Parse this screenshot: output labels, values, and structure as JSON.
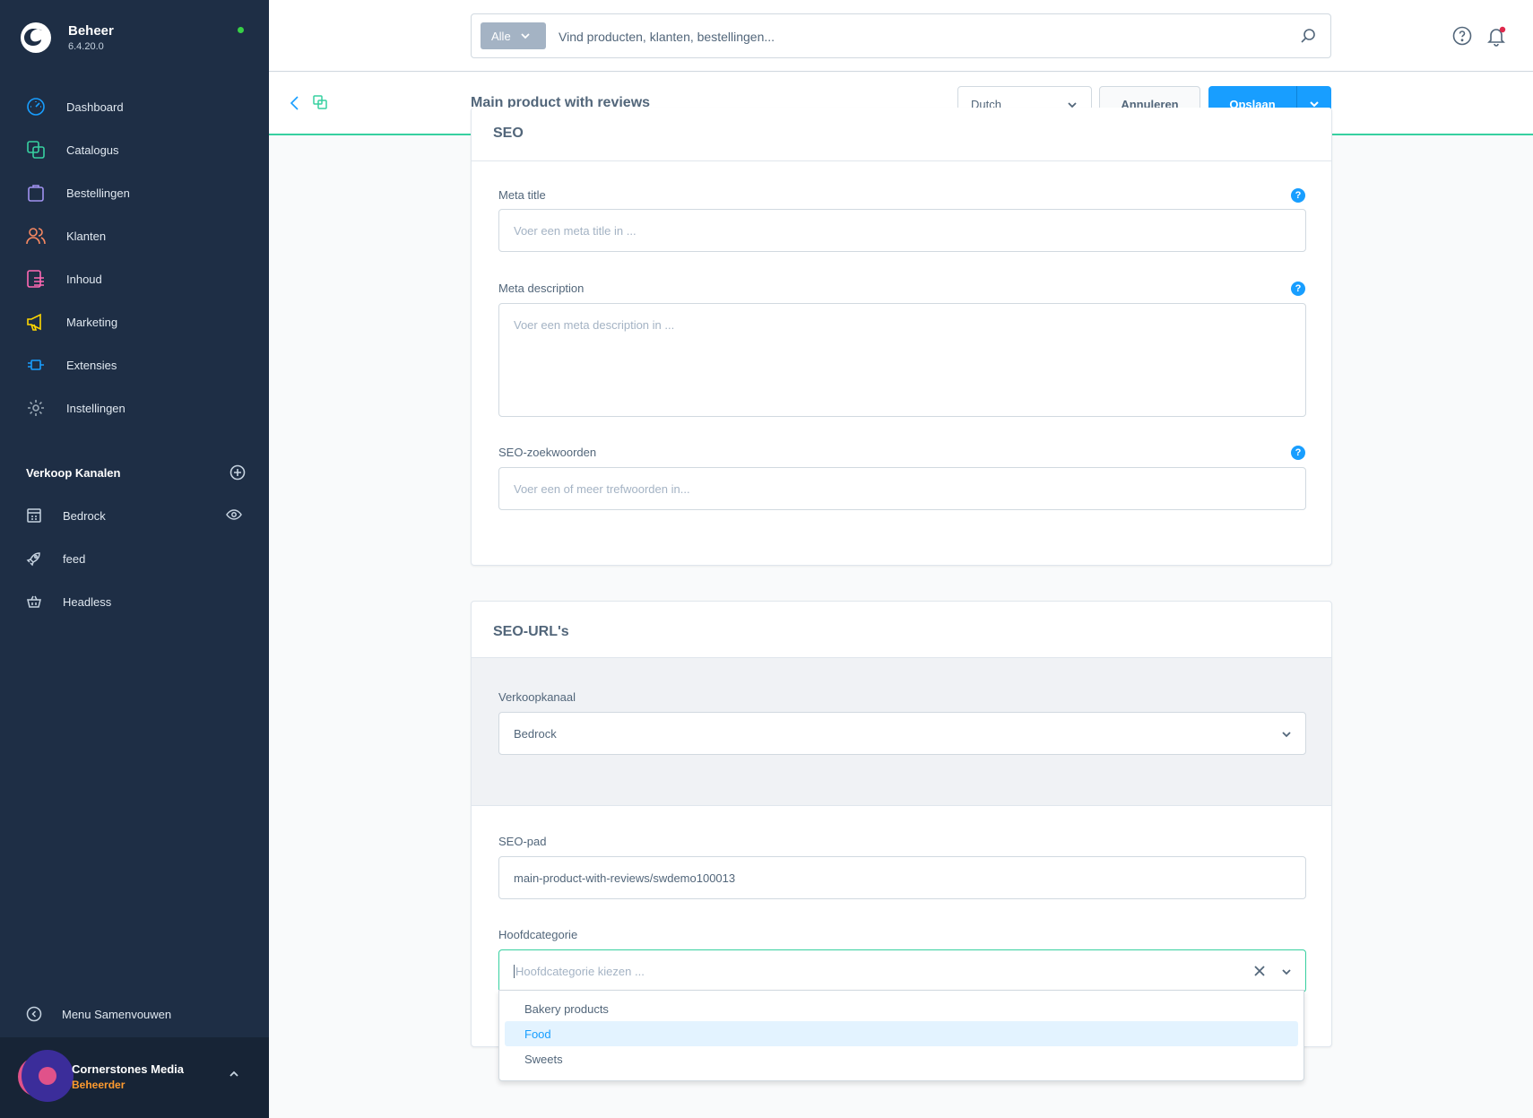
{
  "brand": {
    "name": "Beheer",
    "version": "6.4.20.0"
  },
  "nav": {
    "items": [
      {
        "label": "Dashboard",
        "icon": "dashboard-icon"
      },
      {
        "label": "Catalogus",
        "icon": "catalogue-icon"
      },
      {
        "label": "Bestellingen",
        "icon": "orders-icon"
      },
      {
        "label": "Klanten",
        "icon": "customers-icon"
      },
      {
        "label": "Inhoud",
        "icon": "content-icon"
      },
      {
        "label": "Marketing",
        "icon": "marketing-icon"
      },
      {
        "label": "Extensies",
        "icon": "extensions-icon"
      },
      {
        "label": "Instellingen",
        "icon": "settings-icon"
      }
    ]
  },
  "channels": {
    "title": "Verkoop Kanalen",
    "items": [
      {
        "label": "Bedrock",
        "icon": "storefront-icon"
      },
      {
        "label": "feed",
        "icon": "rocket-icon"
      },
      {
        "label": "Headless",
        "icon": "basket-icon"
      }
    ]
  },
  "sidebar_footer": {
    "collapse_label": "Menu Samenvouwen"
  },
  "user": {
    "name": "Cornerstones Media",
    "role": "Beheerder"
  },
  "search": {
    "type_label": "Alle",
    "placeholder": "Vind producten, klanten, bestellingen..."
  },
  "smartbar": {
    "title": "Main product with reviews",
    "language": "Dutch",
    "cancel_label": "Annuleren",
    "save_label": "Opslaan"
  },
  "seo_card": {
    "title": "SEO",
    "meta_title_label": "Meta title",
    "meta_title_placeholder": "Voer een meta title in ...",
    "meta_description_label": "Meta description",
    "meta_description_placeholder": "Voer een meta description in ...",
    "keywords_label": "SEO-zoekwoorden",
    "keywords_placeholder": "Voer een of meer trefwoorden in...",
    "help_glyph": "?"
  },
  "seo_urls_card": {
    "title": "SEO-URL's",
    "channel_label": "Verkoopkanaal",
    "channel_value": "Bedrock",
    "path_label": "SEO-pad",
    "path_value": "main-product-with-reviews/swdemo100013",
    "category_label": "Hoofdcategorie",
    "category_placeholder": "Hoofdcategorie kiezen ...",
    "category_options": [
      "Bakery products",
      "Food",
      "Sweets"
    ]
  },
  "colors": {
    "sidebar": "#1e2e45",
    "primary": "#189eff",
    "accent_green": "#37d0a0",
    "user_role": "#ff9b2f"
  }
}
